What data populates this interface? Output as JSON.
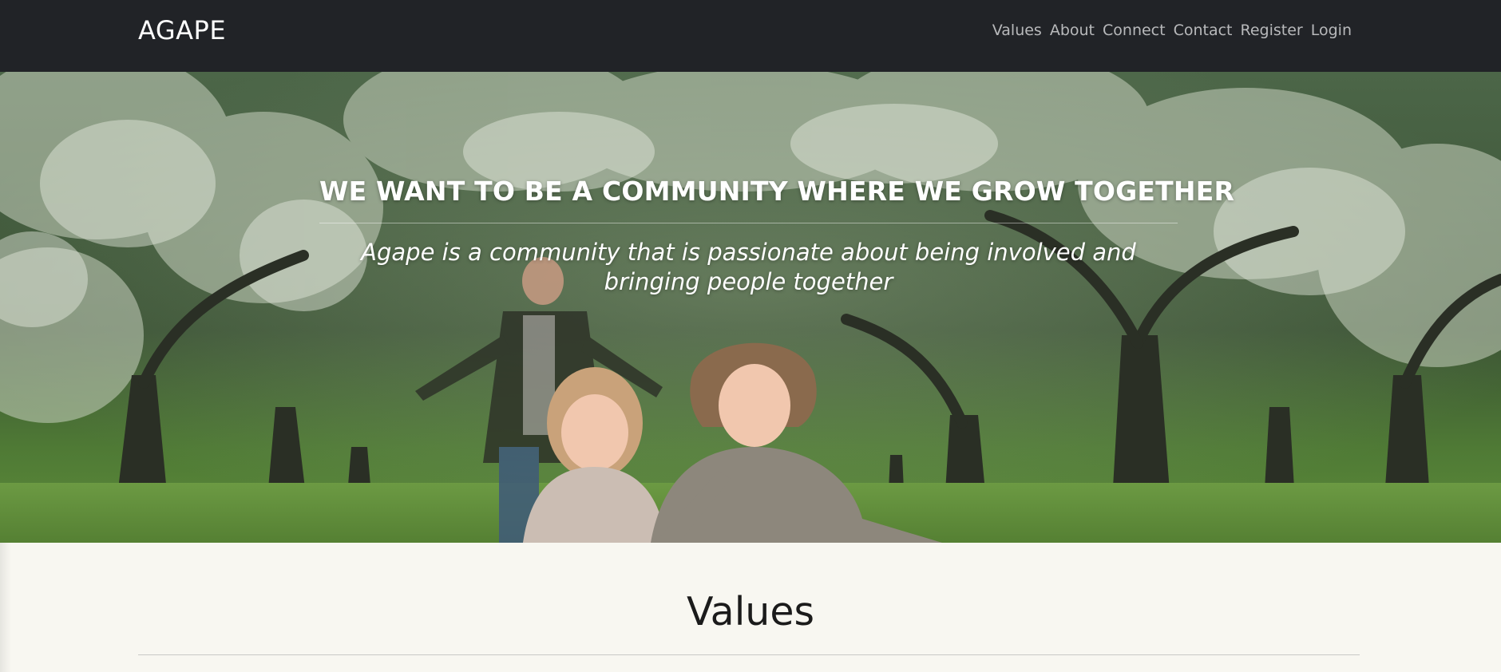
{
  "navbar": {
    "brand": "AGAPE",
    "links": [
      "Values",
      "About",
      "Connect",
      "Contact",
      "Register",
      "Login"
    ]
  },
  "hero": {
    "title": "WE WANT TO BE A COMMUNITY WHERE WE GROW TOGETHER",
    "subtitle_line1": "Agape is a community that is passionate about being involved and",
    "subtitle_line2": "bringing people together"
  },
  "values": {
    "heading": "Values"
  },
  "colors": {
    "navbar_bg": "#212327",
    "nav_link": "#b8b9bb",
    "page_bg": "#f8f7f1",
    "heading_text": "#1b1b1b"
  }
}
